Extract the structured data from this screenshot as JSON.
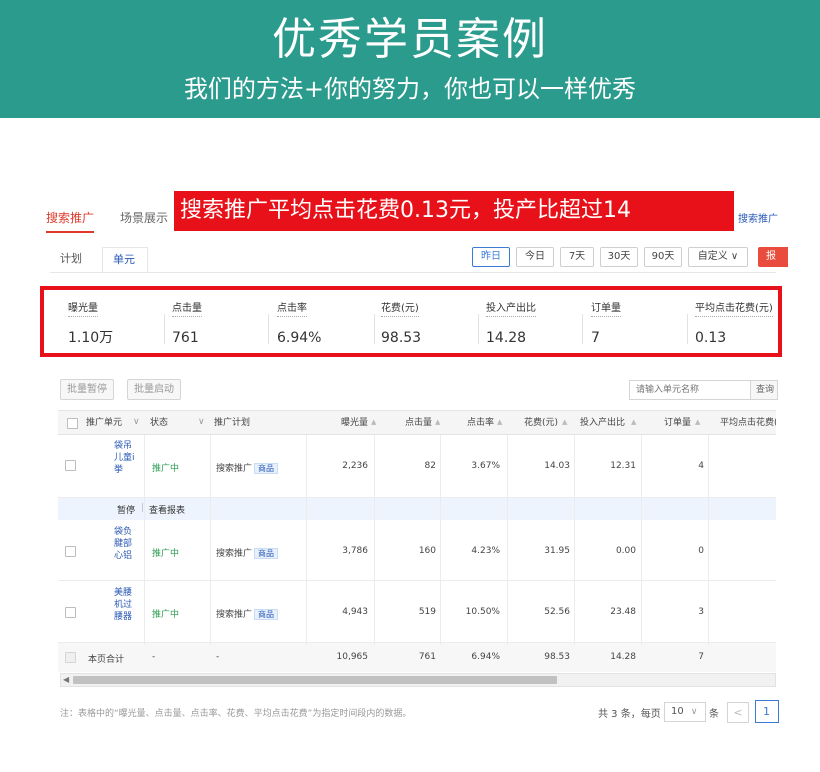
{
  "banner": {
    "title": "优秀学员案例",
    "subtitle": "我们的方法+你的努力，你也可以一样优秀"
  },
  "top_tabs": [
    {
      "label": "搜索推广",
      "active": true
    },
    {
      "label": "场景展示",
      "active": false
    }
  ],
  "top_right_link": "搜索推广",
  "overlay_caption": "搜索推广平均点击花费0.13元，投产比超过14",
  "sub_tabs": [
    {
      "label": "计划",
      "active": false
    },
    {
      "label": "单元",
      "active": true
    }
  ],
  "date_buttons": [
    {
      "label": "昨日",
      "active": true
    },
    {
      "label": "今日",
      "active": false
    },
    {
      "label": "7天",
      "active": false
    },
    {
      "label": "30天",
      "active": false
    },
    {
      "label": "90天",
      "active": false
    },
    {
      "label": "自定义 ∨",
      "active": false
    }
  ],
  "report_button": "报",
  "stats": [
    {
      "label": "曝光量",
      "value": "1.10万"
    },
    {
      "label": "点击量",
      "value": "761"
    },
    {
      "label": "点击率",
      "value": "6.94%"
    },
    {
      "label": "花费(元)",
      "value": "98.53"
    },
    {
      "label": "投入产出比",
      "value": "14.28"
    },
    {
      "label": "订单量",
      "value": "7"
    },
    {
      "label": "平均点击花费(元)",
      "value": "0.13"
    }
  ],
  "batch_buttons": [
    "批量暂停",
    "批量启动"
  ],
  "search": {
    "placeholder": "请输入单元名称",
    "button": "查询"
  },
  "table": {
    "columns": [
      "推广单元",
      "状态",
      "推广计划",
      "曝光量",
      "点击量",
      "点击率",
      "花费(元)",
      "投入产出比",
      "订单量",
      "平均点击花费("
    ],
    "rows": [
      {
        "unit": "袋吊儿童i挙",
        "status": "推广中",
        "plan": "搜索推广",
        "plan_tag": "商品",
        "impressions": "2,236",
        "clicks": "82",
        "ctr": "3.67%",
        "cost": "14.03",
        "roi": "12.31",
        "orders": "4"
      },
      {
        "unit": "袋负腱部心铝",
        "status": "推广中",
        "plan": "搜索推广",
        "plan_tag": "商品",
        "impressions": "3,786",
        "clicks": "160",
        "ctr": "4.23%",
        "cost": "31.95",
        "roi": "0.00",
        "orders": "0"
      },
      {
        "unit": "美腰机过腰器",
        "status": "推广中",
        "plan": "搜索推广",
        "plan_tag": "商品",
        "impressions": "4,943",
        "clicks": "519",
        "ctr": "10.50%",
        "cost": "52.56",
        "roi": "23.48",
        "orders": "3"
      }
    ],
    "row_actions": [
      "暂停",
      "查看报表"
    ],
    "summary": {
      "label": "本页合计",
      "status": "-",
      "plan": "-",
      "impressions": "10,965",
      "clicks": "761",
      "ctr": "6.94%",
      "cost": "98.53",
      "roi": "14.28",
      "orders": "7"
    }
  },
  "footnote": "注：表格中的“曝光量、点击量、点击率、花费、平均点击花费”为指定时间段内的数据。",
  "pager": {
    "total": "共 3 条，每页",
    "size": "10",
    "unit": "条",
    "prev": "<",
    "page": "1"
  },
  "colors": {
    "banner": "#2a9b8c",
    "highlight": "#e8111a",
    "link": "#2a5ab6",
    "status": "#2a9b4f"
  }
}
